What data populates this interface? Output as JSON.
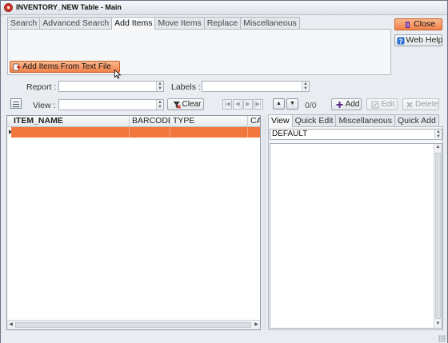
{
  "window": {
    "title": "INVENTORY_NEW Table - Main"
  },
  "top_tabs": [
    "Search",
    "Advanced Search",
    "Add Items",
    "Move Items",
    "Replace",
    "Miscellaneous"
  ],
  "active_top_tab": "Add Items",
  "actions": {
    "add_from_file": "Add Items From Text File",
    "close": "Close",
    "web_help": "Web Help"
  },
  "filters": {
    "report_label": "Report :",
    "report_value": "",
    "labels_label": "Labels :",
    "labels_value": "",
    "view_label": "View :",
    "view_value": "",
    "clear": "Clear"
  },
  "record_nav": {
    "count": "0/0",
    "add": "Add",
    "edit": "Edit",
    "delete": "Delete"
  },
  "grid": {
    "columns": [
      "ITEM_NAME",
      "BARCODE",
      "TYPE",
      "CA"
    ],
    "rows": [
      [
        "",
        "",
        "",
        ""
      ]
    ]
  },
  "right_tabs": [
    "View",
    "Quick Edit",
    "Miscellaneous",
    "Quick Add"
  ],
  "active_right_tab": "View",
  "right_view_combo": "DEFAULT",
  "icons": {
    "app": "app-logo-icon",
    "add_from_file": "add-file-icon",
    "close": "door-exit-icon",
    "help": "question-icon",
    "clear": "funnel-clear-icon",
    "add": "add-record-icon",
    "edit": "edit-icon",
    "delete": "delete-icon"
  },
  "colors": {
    "accent": "#f1773d",
    "accent_border": "#c65f28"
  }
}
